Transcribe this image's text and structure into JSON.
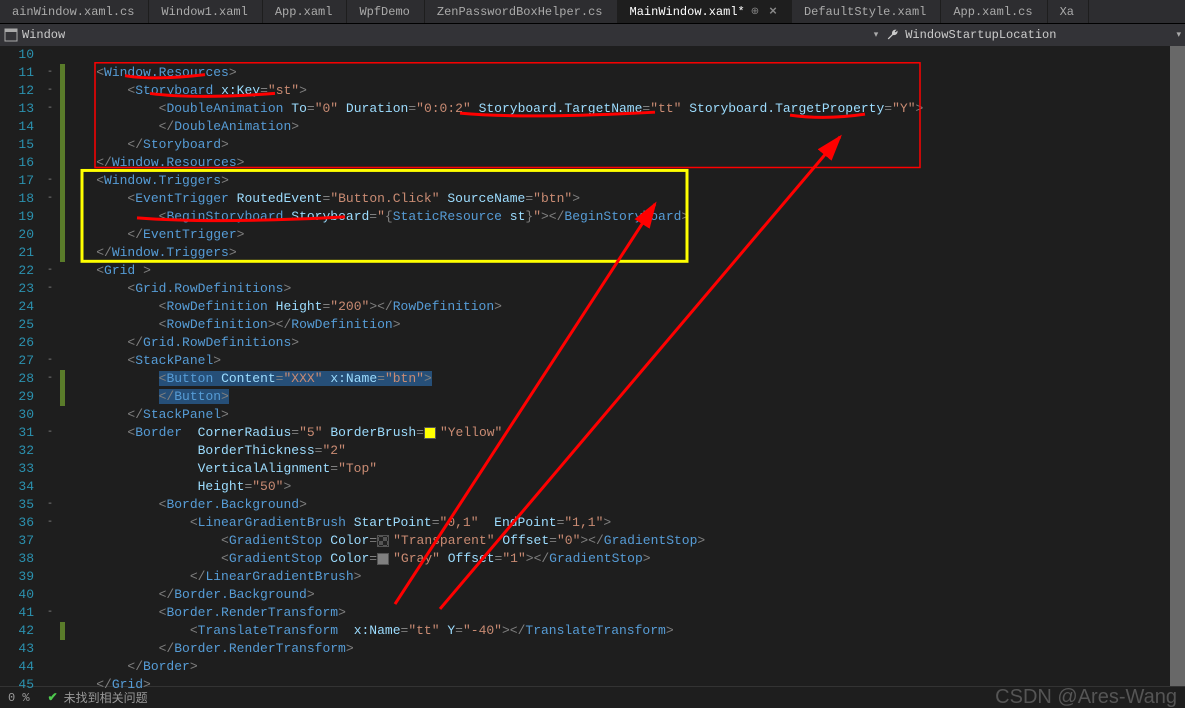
{
  "tabs": [
    {
      "label": "ainWindow.xaml.cs",
      "active": false
    },
    {
      "label": "Window1.xaml",
      "active": false
    },
    {
      "label": "App.xaml",
      "active": false
    },
    {
      "label": "WpfDemo",
      "active": false
    },
    {
      "label": "ZenPasswordBoxHelper.cs",
      "active": false
    },
    {
      "label": "MainWindow.xaml*",
      "active": true,
      "pin": true,
      "close": true
    },
    {
      "label": "DefaultStyle.xaml",
      "active": false
    },
    {
      "label": "App.xaml.cs",
      "active": false
    },
    {
      "label": "Xa",
      "active": false
    }
  ],
  "nav": {
    "left": "Window",
    "right": "WindowStartupLocation"
  },
  "lines": [
    {
      "n": 10,
      "fold": "",
      "bar": "",
      "html": ""
    },
    {
      "n": 11,
      "fold": "-",
      "bar": "c",
      "html": "    <span class='p-punc'>&lt;</span><span class='p-blue'>Window.Resources</span><span class='p-punc'>&gt;</span>"
    },
    {
      "n": 12,
      "fold": "-",
      "bar": "c",
      "html": "        <span class='p-punc'>&lt;</span><span class='p-blue'>Storyboard</span> <span class='p-attr'>x:Key</span><span class='p-punc'>=</span><span class='p-str'>\"st\"</span><span class='p-punc'>&gt;</span>"
    },
    {
      "n": 13,
      "fold": "-",
      "bar": "c",
      "html": "            <span class='p-punc'>&lt;</span><span class='p-blue'>DoubleAnimation</span> <span class='p-attr'>To</span><span class='p-punc'>=</span><span class='p-str'>\"0\"</span> <span class='p-attr'>Duration</span><span class='p-punc'>=</span><span class='p-str'>\"0:0:2\"</span> <span class='p-attr'>Storyboard.TargetName</span><span class='p-punc'>=</span><span class='p-str'>\"tt\"</span> <span class='p-attr'>Storyboard.TargetProperty</span><span class='p-punc'>=</span><span class='p-str'>\"Y\"</span><span class='p-punc'>&gt;</span>"
    },
    {
      "n": 14,
      "fold": "",
      "bar": "c",
      "html": "            <span class='p-punc'>&lt;/</span><span class='p-blue'>DoubleAnimation</span><span class='p-punc'>&gt;</span>"
    },
    {
      "n": 15,
      "fold": "",
      "bar": "c",
      "html": "        <span class='p-punc'>&lt;/</span><span class='p-blue'>Storyboard</span><span class='p-punc'>&gt;</span>"
    },
    {
      "n": 16,
      "fold": "",
      "bar": "c",
      "html": "    <span class='p-punc'>&lt;/</span><span class='p-blue'>Window.Resources</span><span class='p-punc'>&gt;</span>"
    },
    {
      "n": 17,
      "fold": "-",
      "bar": "c",
      "html": "    <span class='p-punc'>&lt;</span><span class='p-blue'>Window.Triggers</span><span class='p-punc'>&gt;</span>"
    },
    {
      "n": 18,
      "fold": "-",
      "bar": "c",
      "html": "        <span class='p-punc'>&lt;</span><span class='p-blue'>EventTrigger</span> <span class='p-attr'>RoutedEvent</span><span class='p-punc'>=</span><span class='p-str'>\"Button.Click\"</span> <span class='p-attr'>SourceName</span><span class='p-punc'>=</span><span class='p-str'>\"btn\"</span><span class='p-punc'>&gt;</span>"
    },
    {
      "n": 19,
      "fold": "",
      "bar": "c",
      "html": "            <span class='p-punc'>&lt;</span><span class='p-blue'>BeginStoryboard</span> <span class='p-attr'>Storyboard</span><span class='p-punc'>=</span><span class='p-str'>\"</span><span class='p-punc'>{</span><span class='p-blue'>StaticResource</span> <span class='p-attr'>st</span><span class='p-punc'>}</span><span class='p-str'>\"</span><span class='p-punc'>&gt;&lt;/</span><span class='p-blue'>BeginStoryboard</span><span class='p-punc'>&gt;</span>"
    },
    {
      "n": 20,
      "fold": "",
      "bar": "c",
      "html": "        <span class='p-punc'>&lt;/</span><span class='p-blue'>EventTrigger</span><span class='p-punc'>&gt;</span>"
    },
    {
      "n": 21,
      "fold": "",
      "bar": "c",
      "html": "    <span class='p-punc'>&lt;/</span><span class='p-blue'>Window.Triggers</span><span class='p-punc'>&gt;</span>"
    },
    {
      "n": 22,
      "fold": "-",
      "bar": "",
      "html": "    <span class='p-punc'>&lt;</span><span class='p-blue'>Grid</span> <span class='p-punc'>&gt;</span>"
    },
    {
      "n": 23,
      "fold": "-",
      "bar": "",
      "html": "        <span class='p-punc'>&lt;</span><span class='p-blue'>Grid.RowDefinitions</span><span class='p-punc'>&gt;</span>"
    },
    {
      "n": 24,
      "fold": "",
      "bar": "",
      "html": "            <span class='p-punc'>&lt;</span><span class='p-blue'>RowDefinition</span> <span class='p-attr'>Height</span><span class='p-punc'>=</span><span class='p-str'>\"200\"</span><span class='p-punc'>&gt;&lt;/</span><span class='p-blue'>RowDefinition</span><span class='p-punc'>&gt;</span>"
    },
    {
      "n": 25,
      "fold": "",
      "bar": "",
      "html": "            <span class='p-punc'>&lt;</span><span class='p-blue'>RowDefinition</span><span class='p-punc'>&gt;&lt;/</span><span class='p-blue'>RowDefinition</span><span class='p-punc'>&gt;</span>"
    },
    {
      "n": 26,
      "fold": "",
      "bar": "",
      "html": "        <span class='p-punc'>&lt;/</span><span class='p-blue'>Grid.RowDefinitions</span><span class='p-punc'>&gt;</span>"
    },
    {
      "n": 27,
      "fold": "-",
      "bar": "",
      "html": "        <span class='p-punc'>&lt;</span><span class='p-blue'>StackPanel</span><span class='p-punc'>&gt;</span>"
    },
    {
      "n": 28,
      "fold": "-",
      "bar": "c",
      "html": "            <span class='p-sel'><span class='p-punc'>&lt;</span><span class='p-blue'>Button</span> <span class='p-attr'>Content</span><span class='p-punc'>=</span><span class='p-str'>\"XXX\"</span> <span class='p-attr'>x:Name</span><span class='p-punc'>=</span><span class='p-str'>\"btn\"</span><span class='p-punc'>&gt;</span></span>"
    },
    {
      "n": 29,
      "fold": "",
      "bar": "c",
      "html": "            <span class='p-sel'><span class='p-punc'>&lt;/</span><span class='p-blue'>Button</span><span class='p-punc'>&gt;</span></span>"
    },
    {
      "n": 30,
      "fold": "",
      "bar": "",
      "html": "        <span class='p-punc'>&lt;/</span><span class='p-blue'>StackPanel</span><span class='p-punc'>&gt;</span>"
    },
    {
      "n": 31,
      "fold": "-",
      "bar": "",
      "html": "        <span class='p-punc'>&lt;</span><span class='p-blue'>Border</span>  <span class='p-attr'>CornerRadius</span><span class='p-punc'>=</span><span class='p-str'>\"5\"</span> <span class='p-attr'>BorderBrush</span><span class='p-punc'>=</span><span class='color-swatch swatch-yellow'></span><span class='p-str'>\"Yellow\"</span>"
    },
    {
      "n": 32,
      "fold": "",
      "bar": "",
      "html": "                 <span class='p-attr'>BorderThickness</span><span class='p-punc'>=</span><span class='p-str'>\"2\"</span>"
    },
    {
      "n": 33,
      "fold": "",
      "bar": "",
      "html": "                 <span class='p-attr'>VerticalAlignment</span><span class='p-punc'>=</span><span class='p-str'>\"Top\"</span>"
    },
    {
      "n": 34,
      "fold": "",
      "bar": "",
      "html": "                 <span class='p-attr'>Height</span><span class='p-punc'>=</span><span class='p-str'>\"50\"</span><span class='p-punc'>&gt;</span>"
    },
    {
      "n": 35,
      "fold": "-",
      "bar": "",
      "html": "            <span class='p-punc'>&lt;</span><span class='p-blue'>Border.Background</span><span class='p-punc'>&gt;</span>"
    },
    {
      "n": 36,
      "fold": "-",
      "bar": "",
      "html": "                <span class='p-punc'>&lt;</span><span class='p-blue'>LinearGradientBrush</span> <span class='p-attr'>StartPoint</span><span class='p-punc'>=</span><span class='p-str'>\"0,1\"</span>  <span class='p-attr'>EndPoint</span><span class='p-punc'>=</span><span class='p-str'>\"1,1\"</span><span class='p-punc'>&gt;</span>"
    },
    {
      "n": 37,
      "fold": "",
      "bar": "",
      "html": "                    <span class='p-punc'>&lt;</span><span class='p-blue'>GradientStop</span> <span class='p-attr'>Color</span><span class='p-punc'>=</span><span class='color-swatch swatch-transparent'></span><span class='p-str'>\"Transparent\"</span> <span class='p-attr'>Offset</span><span class='p-punc'>=</span><span class='p-str'>\"0\"</span><span class='p-punc'>&gt;&lt;/</span><span class='p-blue'>GradientStop</span><span class='p-punc'>&gt;</span>"
    },
    {
      "n": 38,
      "fold": "",
      "bar": "",
      "html": "                    <span class='p-punc'>&lt;</span><span class='p-blue'>GradientStop</span> <span class='p-attr'>Color</span><span class='p-punc'>=</span><span class='color-swatch swatch-gray'></span><span class='p-str'>\"Gray\"</span> <span class='p-attr'>Offset</span><span class='p-punc'>=</span><span class='p-str'>\"1\"</span><span class='p-punc'>&gt;&lt;/</span><span class='p-blue'>GradientStop</span><span class='p-punc'>&gt;</span>"
    },
    {
      "n": 39,
      "fold": "",
      "bar": "",
      "html": "                <span class='p-punc'>&lt;/</span><span class='p-blue'>LinearGradientBrush</span><span class='p-punc'>&gt;</span>"
    },
    {
      "n": 40,
      "fold": "",
      "bar": "",
      "html": "            <span class='p-punc'>&lt;/</span><span class='p-blue'>Border.Background</span><span class='p-punc'>&gt;</span>"
    },
    {
      "n": 41,
      "fold": "-",
      "bar": "",
      "html": "            <span class='p-punc'>&lt;</span><span class='p-blue'>Border.RenderTransform</span><span class='p-punc'>&gt;</span>"
    },
    {
      "n": 42,
      "fold": "",
      "bar": "c",
      "html": "                <span class='p-punc'>&lt;</span><span class='p-blue'>TranslateTransform</span>  <span class='p-attr'>x:Name</span><span class='p-punc'>=</span><span class='p-str'>\"tt\"</span> <span class='p-attr'>Y</span><span class='p-punc'>=</span><span class='p-str'>\"-40\"</span><span class='p-punc'>&gt;&lt;/</span><span class='p-blue'>TranslateTransform</span><span class='p-punc'>&gt;</span>"
    },
    {
      "n": 43,
      "fold": "",
      "bar": "",
      "html": "            <span class='p-punc'>&lt;/</span><span class='p-blue'>Border.RenderTransform</span><span class='p-punc'>&gt;</span>"
    },
    {
      "n": 44,
      "fold": "",
      "bar": "",
      "html": "        <span class='p-punc'>&lt;/</span><span class='p-blue'>Border</span><span class='p-punc'>&gt;</span>"
    },
    {
      "n": 45,
      "fold": "",
      "bar": "",
      "html": "    <span class='p-punc'>&lt;/</span><span class='p-blue'>Grid</span><span class='p-punc'>&gt;</span>"
    }
  ],
  "status": {
    "left_pct": "0 %",
    "msg": "未找到相关问题",
    "watermark": "CSDN @Ares-Wang"
  }
}
